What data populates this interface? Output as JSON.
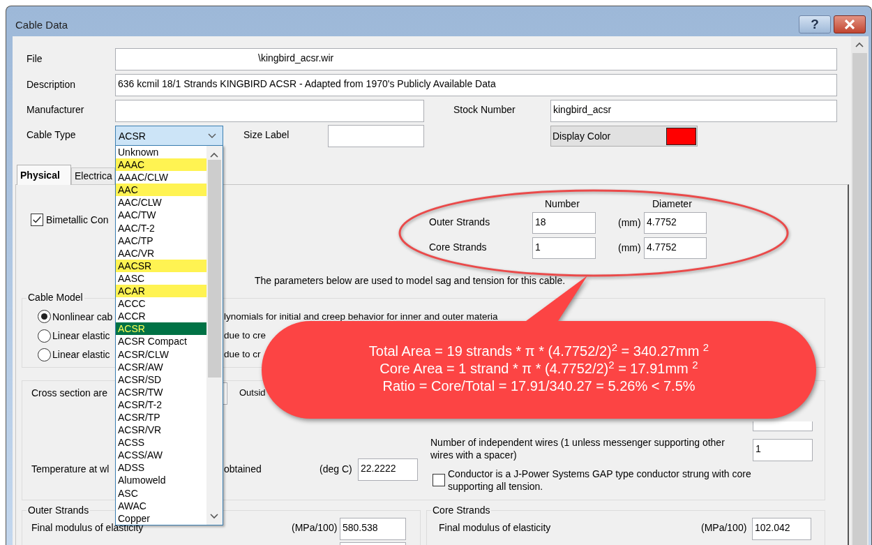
{
  "window": {
    "title": "Cable Data",
    "help_button": "?"
  },
  "file": {
    "label": "File",
    "value": "\\kingbird_acsr.wir"
  },
  "description": {
    "label": "Description",
    "value": "636 kcmil 18/1 Strands KINGBIRD ACSR - Adapted from 1970's Publicly Available Data"
  },
  "manufacturer": {
    "label": "Manufacturer"
  },
  "stock_number": {
    "label": "Stock Number",
    "value": "kingbird_acsr"
  },
  "size_label": {
    "label": "Size Label"
  },
  "display_color": {
    "label": "Display Color",
    "color": "#ff0000"
  },
  "cable_type": {
    "label": "Cable Type",
    "value": "ACSR",
    "expanded": true,
    "options": [
      {
        "label": "Unknown",
        "highlighted": false,
        "selected": false
      },
      {
        "label": "AAAC",
        "highlighted": true,
        "selected": false
      },
      {
        "label": "AAAC/CLW",
        "highlighted": false,
        "selected": false
      },
      {
        "label": "AAC",
        "highlighted": true,
        "selected": false
      },
      {
        "label": "AAC/CLW",
        "highlighted": false,
        "selected": false
      },
      {
        "label": "AAC/TW",
        "highlighted": false,
        "selected": false
      },
      {
        "label": "AAC/T-2",
        "highlighted": false,
        "selected": false
      },
      {
        "label": "AAC/TP",
        "highlighted": false,
        "selected": false
      },
      {
        "label": "AAC/VR",
        "highlighted": false,
        "selected": false
      },
      {
        "label": "AACSR",
        "highlighted": true,
        "selected": false
      },
      {
        "label": "AASC",
        "highlighted": false,
        "selected": false
      },
      {
        "label": "ACAR",
        "highlighted": true,
        "selected": false
      },
      {
        "label": "ACCC",
        "highlighted": false,
        "selected": false
      },
      {
        "label": "ACCR",
        "highlighted": false,
        "selected": false
      },
      {
        "label": "ACSR",
        "highlighted": true,
        "selected": true
      },
      {
        "label": "ACSR Compact",
        "highlighted": false,
        "selected": false
      },
      {
        "label": "ACSR/CLW",
        "highlighted": false,
        "selected": false
      },
      {
        "label": "ACSR/AW",
        "highlighted": false,
        "selected": false
      },
      {
        "label": "ACSR/SD",
        "highlighted": false,
        "selected": false
      },
      {
        "label": "ACSR/TW",
        "highlighted": false,
        "selected": false
      },
      {
        "label": "ACSR/T-2",
        "highlighted": false,
        "selected": false
      },
      {
        "label": "ACSR/TP",
        "highlighted": false,
        "selected": false
      },
      {
        "label": "ACSR/VR",
        "highlighted": false,
        "selected": false
      },
      {
        "label": "ACSS",
        "highlighted": false,
        "selected": false
      },
      {
        "label": "ACSS/AW",
        "highlighted": false,
        "selected": false
      },
      {
        "label": "ADSS",
        "highlighted": false,
        "selected": false
      },
      {
        "label": "Alumoweld",
        "highlighted": false,
        "selected": false
      },
      {
        "label": "ASC",
        "highlighted": false,
        "selected": false
      },
      {
        "label": "AWAC",
        "highlighted": false,
        "selected": false
      },
      {
        "label": "Copper",
        "highlighted": false,
        "selected": false
      }
    ]
  },
  "tabs": [
    {
      "label": "Physical",
      "selected": true
    },
    {
      "label": "Electrica",
      "selected": false
    }
  ],
  "bimetallic": {
    "label": "Bimetallic Con",
    "checked": true
  },
  "strands": {
    "columns": [
      "Number",
      "Diameter"
    ],
    "rows": [
      {
        "label": "Outer Strands",
        "number": "18",
        "unit": "(mm)",
        "diameter": "4.7752"
      },
      {
        "label": "Core Strands",
        "number": "1",
        "unit": "(mm)",
        "diameter": "4.7752"
      }
    ]
  },
  "parameters_note": "The parameters below are used to model sag and tension for this cable.",
  "cable_model": {
    "title": "Cable Model",
    "options": [
      {
        "label": "Nonlinear cab",
        "trailing": "lynomials for initial and creep behavior for inner and outer materia",
        "selected": true
      },
      {
        "label": "Linear elastic",
        "trailing": "due to cre",
        "selected": false
      },
      {
        "label": "Linear elastic",
        "trailing": "due to cr",
        "selected": false
      }
    ]
  },
  "section": {
    "cross_section_label": "Cross section are",
    "outside_label": "Outsid",
    "independent_wires": {
      "label": "Number of independent wires (1 unless messenger supporting other wires with a spacer)",
      "value": "1"
    },
    "temperature": {
      "label": "Temperature at wl",
      "label_end": "obtained",
      "unit": "(deg C)",
      "value": "22.2222"
    },
    "gap_conductor": {
      "label": "Conductor is a J-Power Systems GAP type conductor strung with core supporting all tension.",
      "checked": false
    }
  },
  "outer_strands": {
    "title": "Outer Strands",
    "modulus_label": "Final modulus of elasticity",
    "unit": "(MPa/100)",
    "value": "580.538"
  },
  "core_strands": {
    "title": "Core Strands",
    "modulus_label": "Final modulus of elasticity",
    "unit": "(MPa/100)",
    "value": "102.042"
  },
  "callout": {
    "lines": [
      "Total Area = 19 strands * π * (4.7752/2)$^{2}$ = 340.27mm $^{2}$",
      "Core Area = 1 strand * π * (4.7752/2)$^{2}$ = 17.91mm $^{2}$",
      "Ratio = Core/Total = 17.91/340.27 = 5.26% < 7.5%"
    ]
  }
}
